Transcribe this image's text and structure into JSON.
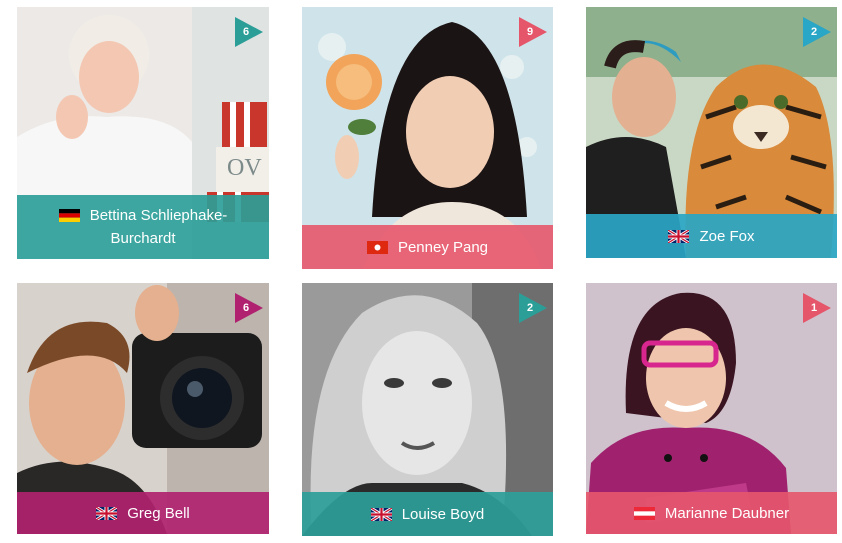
{
  "colors": {
    "teal": "#2c9e98",
    "pink": "#e5566b",
    "blue": "#2aa6c6",
    "magenta": "#b0226f"
  },
  "artists": [
    {
      "name": "Bettina Schliephake-Burchardt",
      "count": "6",
      "flag": "germany-flag",
      "caption_color": "teal",
      "badge_color": "teal",
      "photo": "woman-with-cake"
    },
    {
      "name": "Penney Pang",
      "count": "9",
      "flag": "hong-kong-flag",
      "caption_color": "pink",
      "badge_color": "pink",
      "photo": "woman-with-rose"
    },
    {
      "name": "Zoe Fox",
      "count": "2",
      "flag": "uk-flag",
      "caption_color": "blue",
      "badge_color": "blue",
      "photo": "woman-with-tiger-cake"
    },
    {
      "name": "Greg Bell",
      "count": "6",
      "flag": "uk-flag",
      "caption_color": "magenta",
      "badge_color": "magenta",
      "photo": "man-with-camera"
    },
    {
      "name": "Louise Boyd",
      "count": "2",
      "flag": "uk-flag",
      "caption_color": "teal",
      "badge_color": "teal",
      "photo": "woman-portrait-bw"
    },
    {
      "name": "Marianne Daubner",
      "count": "1",
      "flag": "austria-flag",
      "caption_color": "pink",
      "badge_color": "pink",
      "photo": "woman-in-chef-jacket"
    }
  ]
}
